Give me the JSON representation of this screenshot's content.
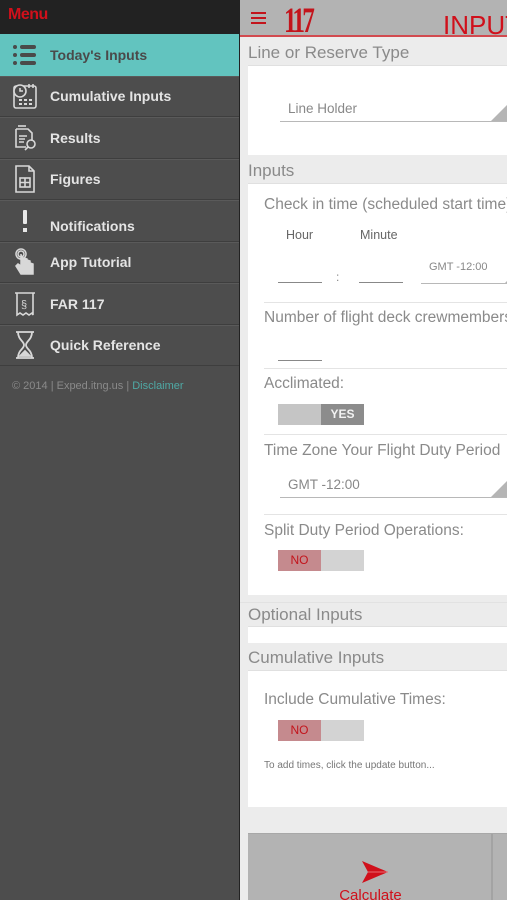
{
  "sidebar": {
    "title": "Menu",
    "items": [
      {
        "label": "Today's Inputs",
        "icon": "list-icon",
        "active": true
      },
      {
        "label": "Cumulative Inputs",
        "icon": "calendar-clock-icon"
      },
      {
        "label": "Results",
        "icon": "document-search-icon"
      },
      {
        "label": "Figures",
        "icon": "document-table-icon"
      },
      {
        "label": "Notifications",
        "icon": "exclamation-icon"
      },
      {
        "label": "App Tutorial",
        "icon": "tap-hand-icon"
      },
      {
        "label": "FAR 117",
        "icon": "scroll-section-icon"
      },
      {
        "label": "Quick Reference",
        "icon": "hourglass-icon"
      }
    ],
    "footer": {
      "copyright": "© 2014 | Exped.itng.us | ",
      "disclaimer": "Disclaimer"
    }
  },
  "header": {
    "logo": "117",
    "title": "INPUTS"
  },
  "sections": {
    "line_reserve": {
      "title": "Line or Reserve Type",
      "select_value": "Line Holder"
    },
    "inputs": {
      "title": "Inputs",
      "checkin_label": "Check in time (scheduled start time)",
      "hour_label": "Hour",
      "minute_label": "Minute",
      "colon": ":",
      "hour_value": "",
      "minute_value": "",
      "checkin_tz": "GMT -12:00",
      "crew_label": "Number of flight deck crewmembers",
      "crew_value": "",
      "acclimated_label": "Acclimated:",
      "acclimated_value": "YES",
      "timezone_label": "Time Zone Your Flight Duty Period",
      "timezone_value": "GMT -12:00",
      "split_label": "Split Duty Period Operations:",
      "split_value": "NO"
    },
    "optional": {
      "title": "Optional Inputs"
    },
    "cumulative": {
      "title": "Cumulative Inputs",
      "include_label": "Include Cumulative Times:",
      "include_value": "NO",
      "hint": "To add times, click the update button..."
    }
  },
  "actions": {
    "calculate": "Calculate"
  },
  "colors": {
    "accent_red": "#d0101b",
    "active_teal": "#62c4bf",
    "sidebar_bg": "#4d4d4d"
  }
}
